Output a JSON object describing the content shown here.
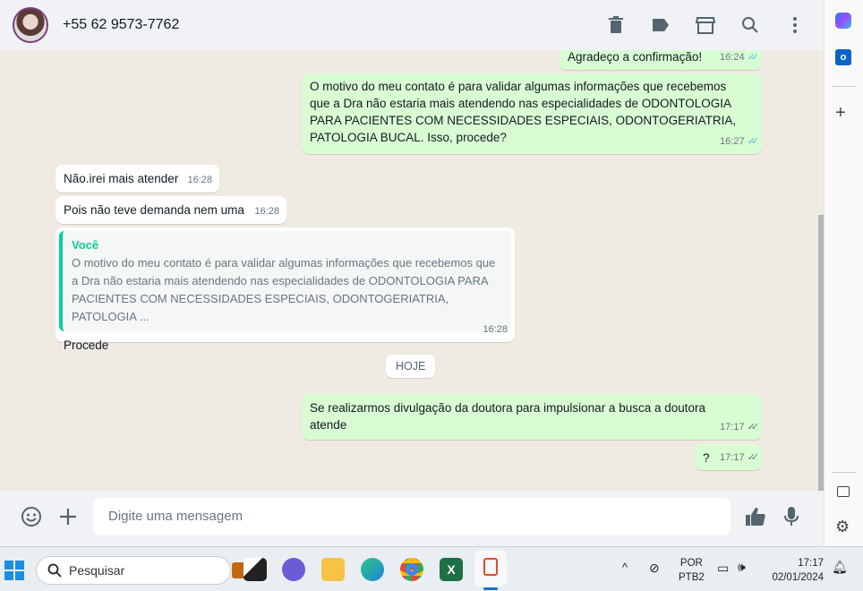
{
  "header": {
    "contact": "+55 62 9573-7762",
    "icons": [
      "delete-icon",
      "label-icon",
      "shop-icon",
      "search-icon",
      "menu-icon"
    ]
  },
  "messages": [
    {
      "dir": "out",
      "text": "Agradeço a confirmação!",
      "time": "16:24"
    },
    {
      "dir": "out",
      "text": "O motivo do meu contato é para validar algumas informações que recebemos que a Dra não estaria mais atendendo nas especialidades de ODONTOLOGIA PARA PACIENTES COM NECESSIDADES ESPECIAIS, ODONTOGERIATRIA, PATOLOGIA BUCAL. Isso, procede?",
      "time": "16:27"
    },
    {
      "dir": "in",
      "text": "Não.irei mais atender",
      "time": "16:28"
    },
    {
      "dir": "in",
      "text": "Pois não teve demanda nem uma",
      "time": "16:28"
    },
    {
      "dir": "in",
      "quote_author": "Você",
      "quote_text": "O motivo do meu contato é para validar algumas informações que recebemos que a Dra não estaria mais atendendo nas especialidades de ODONTOLOGIA PARA PACIENTES COM NECESSIDADES ESPECIAIS, ODONTOGERIATRIA, PATOLOGIA ...",
      "text": "Procede",
      "time": "16:28"
    },
    {
      "dir": "out",
      "text": "Se realizarmos divulgação da doutora para impulsionar a busca a doutora atende",
      "time": "17:17"
    },
    {
      "dir": "out",
      "text": "?",
      "time": "17:17"
    }
  ],
  "day_chip": "HOJE",
  "composer": {
    "placeholder": "Digite uma mensagem"
  },
  "taskbar": {
    "search": "Pesquisar",
    "lang1": "POR",
    "lang2": "PTB2",
    "time": "17:17",
    "date": "02/01/2024"
  }
}
